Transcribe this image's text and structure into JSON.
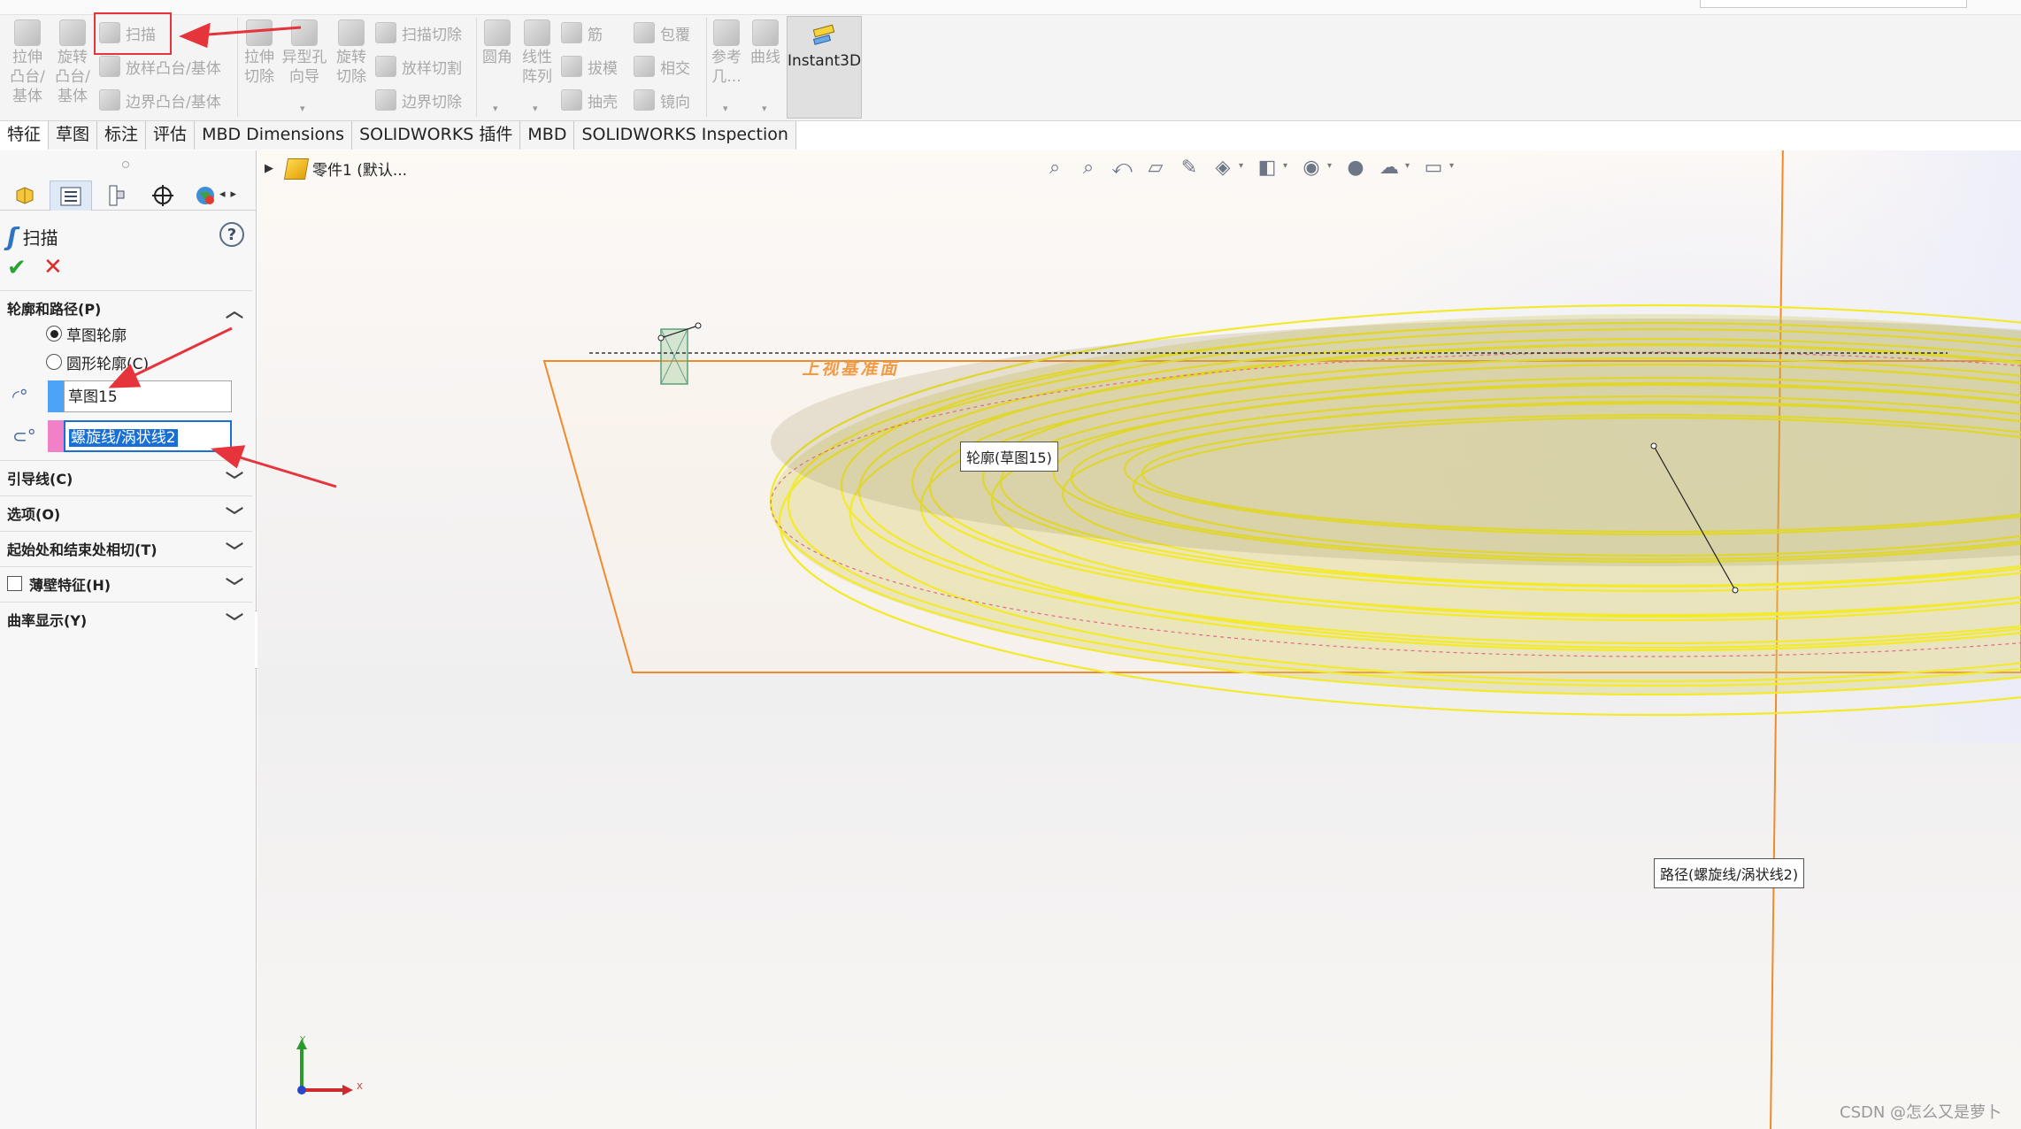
{
  "ribbon": {
    "features": [
      {
        "label": "拉伸\n凸台/\n基体",
        "name": "extrude-boss"
      },
      {
        "label": "旋转\n凸台/\n基体",
        "name": "revolve-boss"
      }
    ],
    "sweep_label": "扫描",
    "loft_label": "放样凸台/基体",
    "boundary_label": "边界凸台/基体",
    "cut_extrude": "拉伸\n切除",
    "hole_wizard": "异型孔\n向导",
    "revolve_cut": "旋转\n切除",
    "sweep_cut": "扫描切除",
    "loft_cut": "放样切割",
    "boundary_cut": "边界切除",
    "fillet": "圆角",
    "linear_pattern": "线性\n阵列",
    "rib": "筋",
    "draft": "拔模",
    "shell": "抽壳",
    "wrap": "包覆",
    "intersect": "相交",
    "mirror": "镜向",
    "reference_geometry": "参考\n几...",
    "curves": "曲线",
    "instant3d": "Instant3D"
  },
  "tabs": [
    {
      "label": "特征",
      "active": true
    },
    {
      "label": "草图",
      "active": false
    },
    {
      "label": "标注",
      "active": false
    },
    {
      "label": "评估",
      "active": false
    },
    {
      "label": "MBD Dimensions",
      "active": false
    },
    {
      "label": "SOLIDWORKS 插件",
      "active": false
    },
    {
      "label": "MBD",
      "active": false
    },
    {
      "label": "SOLIDWORKS Inspection",
      "active": false
    }
  ],
  "panel": {
    "title": "扫描",
    "help": "?",
    "sections": {
      "profile_path": "轮廓和路径(P)",
      "guide_curves": "引导线(C)",
      "options": "选项(O)",
      "tangency": "起始处和结束处相切(T)",
      "thin_feature": "薄壁特征(H)",
      "curvature_display": "曲率显示(Y)"
    },
    "radio_sketch_profile": "草图轮廓",
    "radio_circular_profile": "圆形轮廓(C)",
    "profile_value": "草图15",
    "path_value": "螺旋线/涡状线2",
    "colors": {
      "profile": "#4da3f5",
      "path": "#f080c8"
    }
  },
  "viewport": {
    "tree_item": "零件1  (默认...",
    "plane_label": "上视基准面",
    "callout_profile": "轮廓(草图15)",
    "callout_path": "路径(螺旋线/涡状线2)",
    "triad_y": "Y",
    "triad_x": "X"
  },
  "watermark": "CSDN @怎么又是萝卜",
  "colors": {
    "accent_red": "#e5343b",
    "sweep_yellow": "#f2ea2a",
    "plane_orange": "#f08a2a"
  }
}
